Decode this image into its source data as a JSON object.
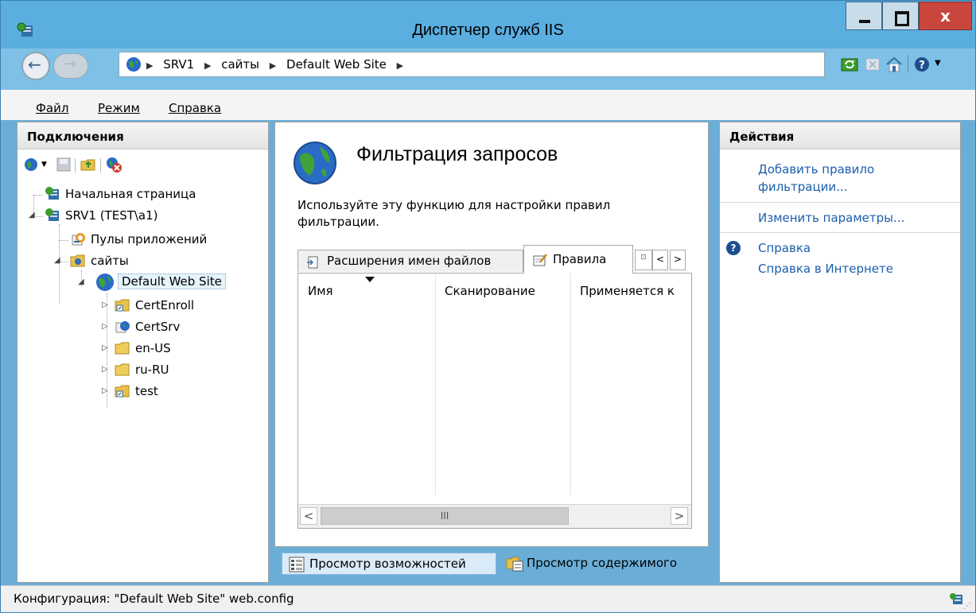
{
  "window": {
    "title": "Диспетчер служб IIS",
    "close_glyph": "x"
  },
  "address": {
    "crumbs": [
      "SRV1",
      "сайты",
      "Default Web Site"
    ]
  },
  "menu": {
    "file": "Файл",
    "view": "Режим",
    "help": "Справка"
  },
  "connections": {
    "header": "Подключения",
    "tree": {
      "start_page": "Начальная страница",
      "server": "SRV1 (TEST\\a1)",
      "app_pools": "Пулы приложений",
      "sites": "сайты",
      "default_site": "Default Web Site",
      "children": [
        "CertEnroll",
        "CertSrv",
        "en-US",
        "ru-RU",
        "test"
      ]
    }
  },
  "feature": {
    "title": "Фильтрация запросов",
    "description": "Используйте эту функцию для настройки правил фильтрации.",
    "tabs": {
      "extensions": "Расширения имен файлов",
      "rules": "Правила"
    },
    "grid": {
      "columns": [
        "Имя",
        "Сканирование",
        "Применяется к"
      ],
      "scroll_thumb_glyph": "III"
    }
  },
  "view_switch": {
    "features": "Просмотр возможностей",
    "content": "Просмотр содержимого"
  },
  "actions": {
    "header": "Действия",
    "add_rule": "Добавить правило фильтрации...",
    "edit_settings": "Изменить параметры...",
    "help": "Справка",
    "online_help": "Справка в Интернете"
  },
  "status": {
    "text": "Конфигурация: \"Default Web Site\" web.config"
  },
  "icons": {
    "globe": "globe-icon",
    "folder": "folder-icon",
    "server": "server-icon",
    "help": "help-icon"
  },
  "colors": {
    "titlebar": "#5aaee0",
    "close_button": "#c9463d",
    "link": "#1a5fad",
    "selection": "#e5f3fb"
  }
}
